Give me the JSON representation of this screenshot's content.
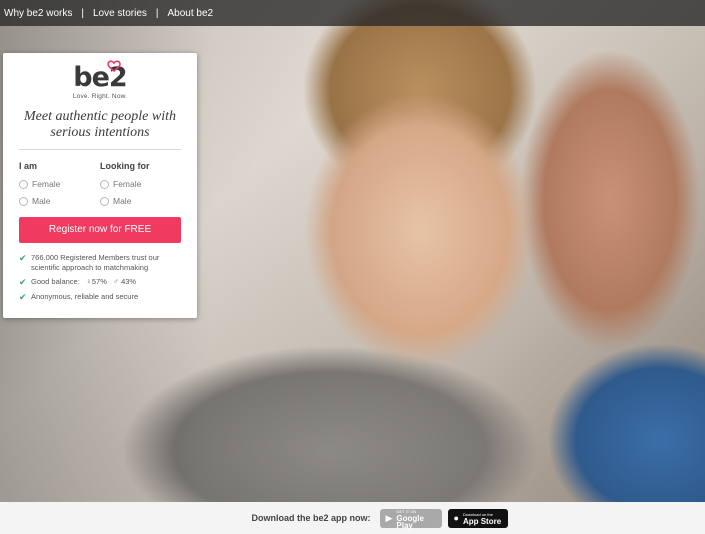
{
  "nav": {
    "items": [
      {
        "label": "Why be2 works"
      },
      {
        "label": "Love stories"
      },
      {
        "label": "About be2"
      }
    ],
    "separator": "|"
  },
  "card": {
    "logo": {
      "mark": "be2",
      "tagline": "Love. Right. Now."
    },
    "headline": "Meet authentic people with serious intentions",
    "i_am": {
      "title": "I am",
      "options": [
        {
          "label": "Female"
        },
        {
          "label": "Male"
        }
      ]
    },
    "looking_for": {
      "title": "Looking for",
      "options": [
        {
          "label": "Female"
        },
        {
          "label": "Male"
        }
      ]
    },
    "register_label": "Register now for FREE",
    "benefits": {
      "members": "766.000 Registered Members trust our scientific approach to matchmaking",
      "balance_label": "Good balance:",
      "female_pct": "57%",
      "male_pct": "43%",
      "secure": "Anonymous, reliable and secure"
    }
  },
  "footer": {
    "text": "Download the be2 app now:",
    "google_play": {
      "small": "GET IT ON",
      "big": "Google Play"
    },
    "app_store": {
      "small": "Download on the",
      "big": "App Store"
    }
  },
  "colors": {
    "accent": "#f03a5f",
    "check": "#3aa06a",
    "nav_bg": "#282828"
  }
}
